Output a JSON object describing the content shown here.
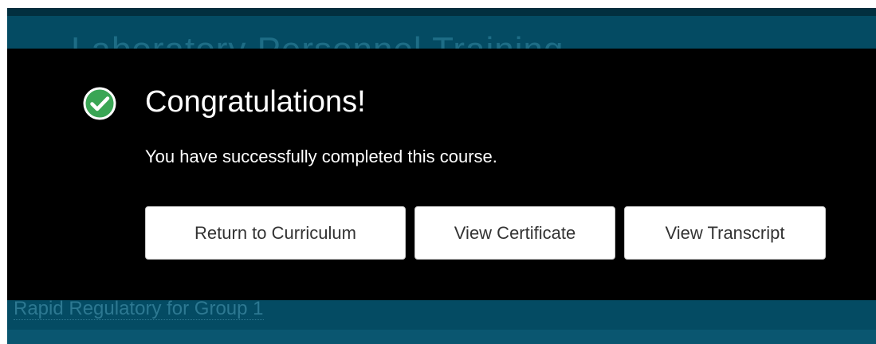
{
  "background": {
    "page_title": "Laboratory Personnel Training",
    "course_link": "Rapid Regulatory for Group 1"
  },
  "dialog": {
    "icon": "check-circle-icon",
    "heading": "Congratulations!",
    "message": "You have successfully completed this course.",
    "buttons": {
      "return": "Return to Curriculum",
      "certificate": "View Certificate",
      "transcript": "View Transcript"
    }
  },
  "colors": {
    "page_background": "#044b63",
    "overlay": "#000000",
    "success": "#3aa655",
    "button_text": "#333333"
  }
}
